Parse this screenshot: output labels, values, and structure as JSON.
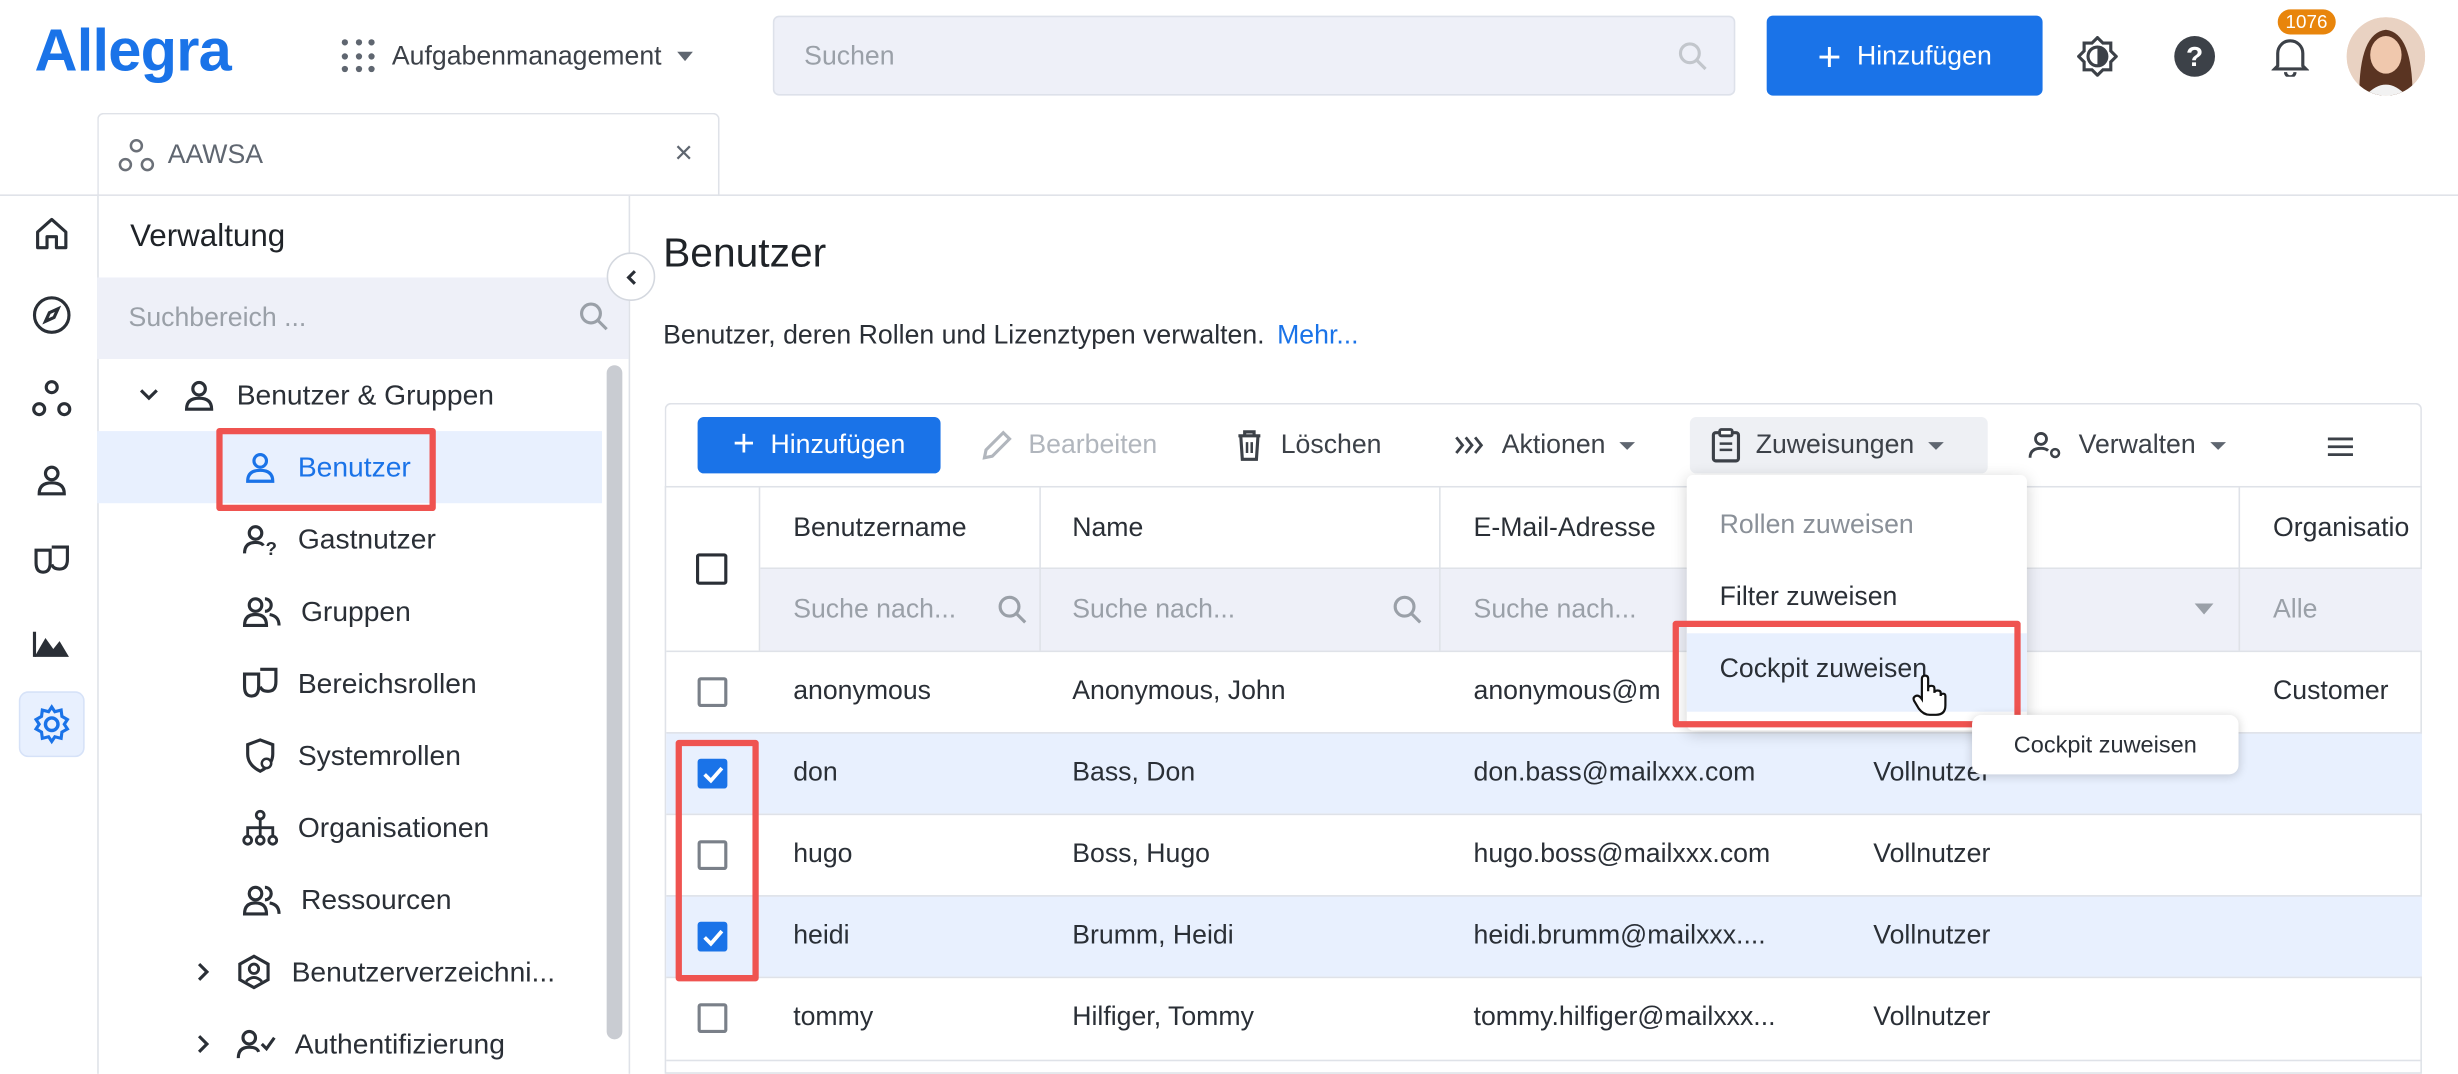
{
  "app": {
    "logo": "Allegra",
    "module": "Aufgabenmanagement",
    "search_placeholder": "Suchen",
    "add_label": "Hinzufügen",
    "notification_count": "1076",
    "accent": "#1a73e8"
  },
  "tab": {
    "label": "AAWSA"
  },
  "rail": {
    "items": [
      "home-icon",
      "compass-icon",
      "network-icon",
      "user-icon",
      "theater-masks-icon",
      "landscape-icon",
      "gear-icon"
    ],
    "active": "gear-icon"
  },
  "sidebar": {
    "title": "Verwaltung",
    "search_placeholder": "Suchbereich ...",
    "group": "Benutzer & Gruppen",
    "items": [
      {
        "label": "Benutzer",
        "icon": "user-icon"
      },
      {
        "label": "Gastnutzer",
        "icon": "guest-user-icon"
      },
      {
        "label": "Gruppen",
        "icon": "group-icon"
      },
      {
        "label": "Bereichsrollen",
        "icon": "masks-icon"
      },
      {
        "label": "Systemrollen",
        "icon": "shield-icon"
      },
      {
        "label": "Organisationen",
        "icon": "org-chart-icon"
      },
      {
        "label": "Ressourcen",
        "icon": "resources-icon"
      },
      {
        "label": "Benutzerverzeichni...",
        "icon": "hexagon-user-icon"
      },
      {
        "label": "Authentifizierung",
        "icon": "user-check-icon"
      }
    ]
  },
  "main": {
    "title": "Benutzer",
    "description": "Benutzer, deren Rollen und Lizenztypen verwalten.",
    "more_link": "Mehr..."
  },
  "toolbar": {
    "add": "Hinzufügen",
    "edit": "Bearbeiten",
    "delete": "Löschen",
    "actions": "Aktionen",
    "assignments": "Zuweisungen",
    "manage": "Verwalten"
  },
  "table": {
    "columns": [
      "Benutzername",
      "Name",
      "E-Mail-Adresse",
      "",
      "Organisatio"
    ],
    "filters": [
      "Suche nach...",
      "Suche nach...",
      "Suche nach...",
      "",
      "Alle"
    ],
    "rows": [
      {
        "checked": false,
        "username": "anonymous",
        "name": "Anonymous, John",
        "email": "anonymous@m",
        "license": "",
        "org": "Customer"
      },
      {
        "checked": true,
        "username": "don",
        "name": "Bass, Don",
        "email": "don.bass@mailxxx.com",
        "license": "Vollnutzer",
        "org": ""
      },
      {
        "checked": false,
        "username": "hugo",
        "name": "Boss, Hugo",
        "email": "hugo.boss@mailxxx.com",
        "license": "Vollnutzer",
        "org": ""
      },
      {
        "checked": true,
        "username": "heidi",
        "name": "Brumm, Heidi",
        "email": "heidi.brumm@mailxxx....",
        "license": "Vollnutzer",
        "org": ""
      },
      {
        "checked": false,
        "username": "tommy",
        "name": "Hilfiger, Tommy",
        "email": "tommy.hilfiger@mailxxx...",
        "license": "Vollnutzer",
        "org": ""
      }
    ]
  },
  "menu": {
    "items": [
      "Rollen zuweisen",
      "Filter zuweisen",
      "Cockpit zuweisen"
    ],
    "tooltip": "Cockpit zuweisen"
  },
  "highlight_color": "#ef5350"
}
